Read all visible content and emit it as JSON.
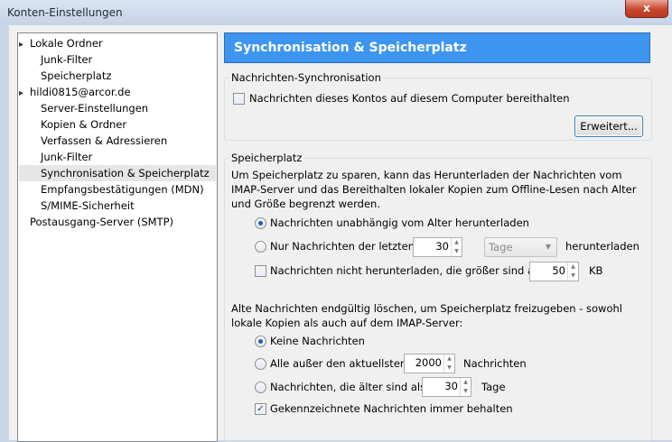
{
  "window": {
    "title": "Konten-Einstellungen",
    "close_glyph": "x"
  },
  "tree": {
    "items": [
      {
        "label": "Lokale Ordner",
        "toggle": "▸"
      },
      {
        "label": "Junk-Filter"
      },
      {
        "label": "Speicherplatz"
      },
      {
        "label": "hildi0815@arcor.de",
        "toggle": "▸"
      },
      {
        "label": "Server-Einstellungen"
      },
      {
        "label": "Kopien & Ordner"
      },
      {
        "label": "Verfassen & Adressieren"
      },
      {
        "label": "Junk-Filter"
      },
      {
        "label": "Synchronisation & Speicherplatz",
        "selected": true
      },
      {
        "label": "Empfangsbestätigungen (MDN)"
      },
      {
        "label": "S/MIME-Sicherheit"
      },
      {
        "label": "Postausgang-Server (SMTP)"
      }
    ]
  },
  "header": {
    "title": "Synchronisation & Speicherplatz"
  },
  "sync": {
    "legend": "Nachrichten-Synchronisation",
    "keep_label": "Nachrichten dieses Kontos auf diesem Computer bereithalten",
    "keep_checked": true,
    "advanced_button": "Erweitert..."
  },
  "storage": {
    "legend": "Speicherplatz",
    "description": "Um Speicherplatz zu sparen, kann das Herunterladen der Nachrichten vom IMAP-Server und das Bereithalten lokaler Kopien zum Offline-Lesen nach Alter und Größe begrenzt werden.",
    "radio_all_label": "Nachrichten unabhängig vom Alter herunterladen",
    "radio_recent_label": "Nur Nachrichten der letzten",
    "recent_value": "30",
    "recent_unit": "Tage",
    "recent_suffix": "herunterladen",
    "size_label": "Nachrichten nicht herunterladen, die größer sind als",
    "size_value": "50",
    "size_unit": "KB",
    "delete_description": "Alte Nachrichten endgültig löschen, um Speicherplatz freizugeben - sowohl lokale Kopien als auch auf dem IMAP-Server:",
    "delete_none_label": "Keine Nachrichten",
    "delete_except_label": "Alle außer den aktuellsten",
    "delete_except_value": "2000",
    "delete_except_suffix": "Nachrichten",
    "delete_older_label": "Nachrichten, die älter sind als",
    "delete_older_value": "30",
    "delete_older_suffix": "Tage",
    "keep_flagged_label": "Gekennzeichnete Nachrichten immer behalten",
    "keep_flagged_checked": true,
    "arrow_up": "▲",
    "arrow_down": "▼",
    "dropdown_arrow": "▼",
    "check_glyph": "✓"
  }
}
